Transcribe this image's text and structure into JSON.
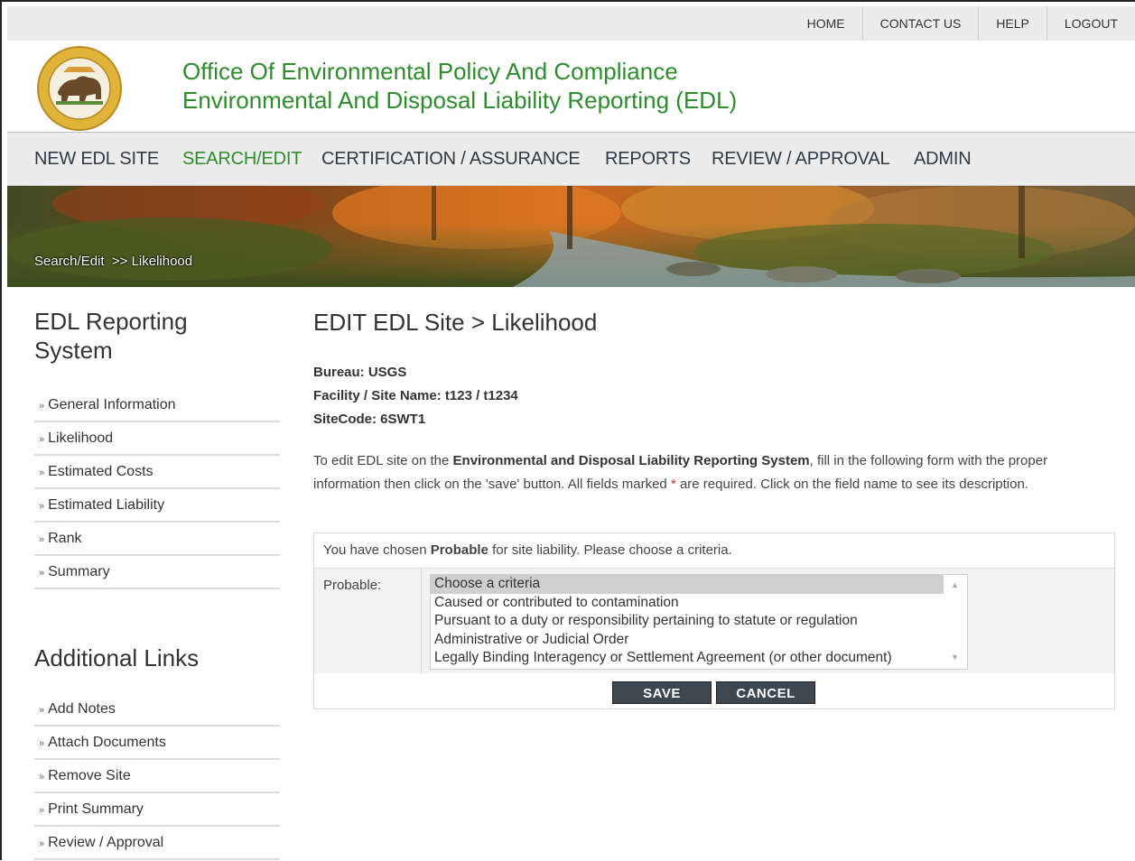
{
  "utility_links": [
    "HOME",
    "CONTACT US",
    "HELP",
    "LOGOUT"
  ],
  "header": {
    "title_line1": "Office Of Environmental Policy And Compliance",
    "title_line2": "Environmental And Disposal Liability Reporting (EDL)"
  },
  "nav": [
    "NEW EDL SITE",
    "SEARCH/EDIT",
    "CERTIFICATION / ASSURANCE",
    "REPORTS",
    "REVIEW / APPROVAL",
    "ADMIN"
  ],
  "nav_active": "SEARCH/EDIT",
  "breadcrumb": "Search/Edit  >> Likelihood",
  "sidebar": {
    "title": "EDL Reporting System",
    "items": [
      "General Information",
      "Likelihood",
      "Estimated Costs",
      "Estimated Liability",
      "Rank",
      "Summary"
    ],
    "links_title": "Additional Links",
    "links": [
      "Add Notes",
      "Attach Documents",
      "Remove Site",
      "Print Summary",
      "Review / Approval"
    ]
  },
  "main": {
    "title": "EDIT EDL Site > Likelihood",
    "bureau": "Bureau: USGS",
    "facility": "Facility / Site Name: t123 / t1234",
    "sitecode": "SiteCode: 6SWT1",
    "desc_1": "To edit EDL site on the ",
    "desc_bold": "Environmental and Disposal Liability Reporting System",
    "desc_2": ", fill in the following form with the proper information then click on the 'save' button. All fields marked ",
    "desc_star": "*",
    "desc_3": " are required. Click on the field name to see its description.",
    "msg_1": "You have chosen ",
    "msg_bold": "Probable",
    "msg_2": " for site liability. Please choose a criteria.",
    "field_label": "Probable:",
    "options": [
      "Choose a criteria",
      "Caused or contributed to contamination",
      "Pursuant to a duty or responsibility pertaining to statute or regulation",
      "Administrative or Judicial Order",
      "Legally Binding Interagency or Settlement Agreement (or other document)"
    ],
    "save_label": "SAVE",
    "cancel_label": "CANCEL"
  },
  "colors": {
    "accent_green": "#2e8b2e",
    "nav_bg": "#ececec",
    "button_bg": "#3c4750"
  }
}
